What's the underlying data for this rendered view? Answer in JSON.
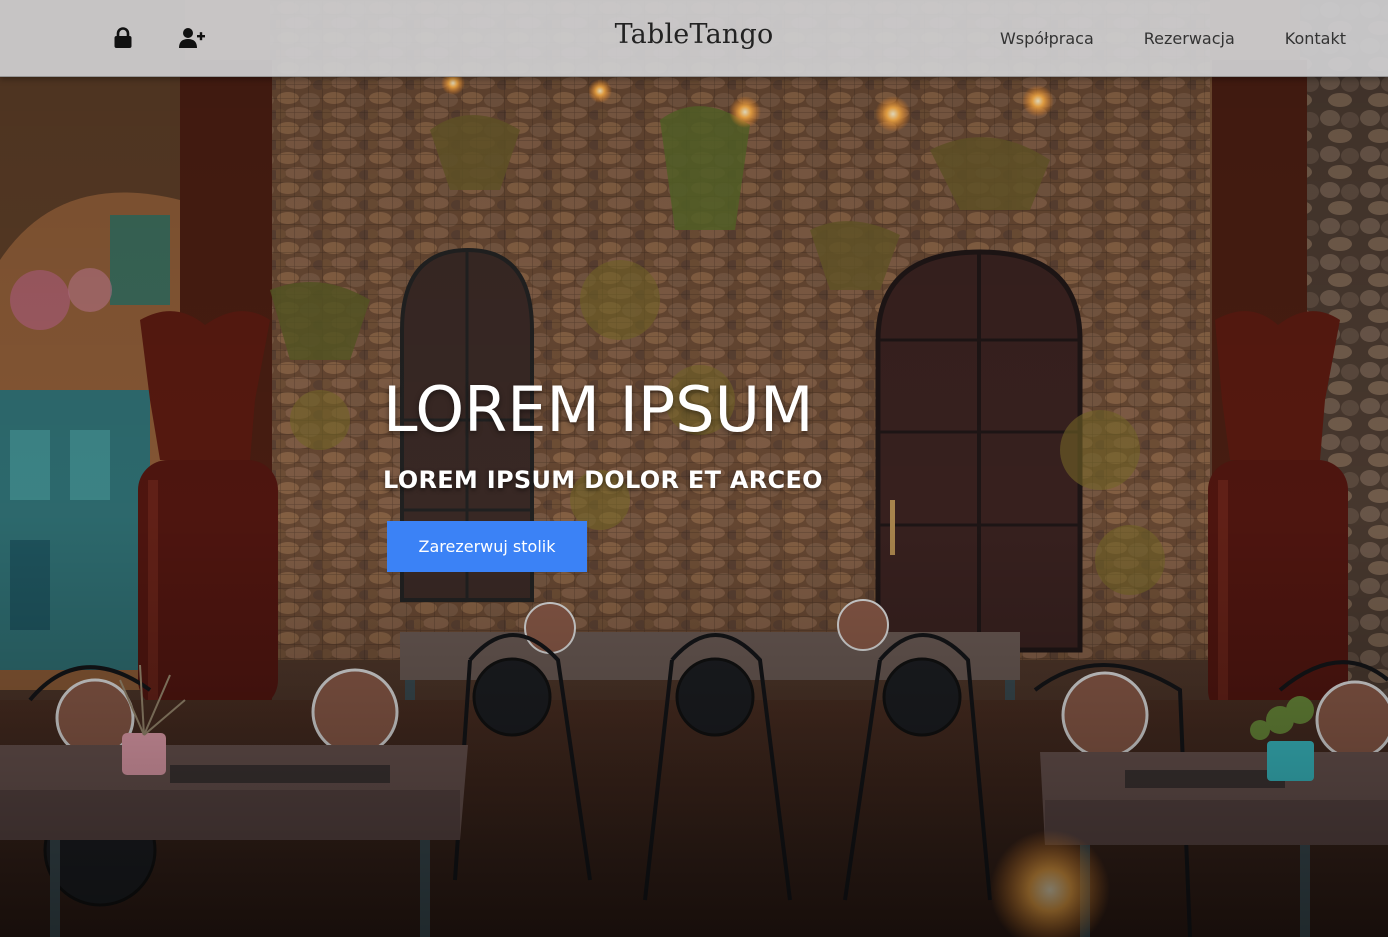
{
  "navbar": {
    "brand": "TableTango",
    "icons": {
      "left": "lock-icon",
      "right": "add-user-icon"
    },
    "links": [
      "Współpraca",
      "Rezerwacja",
      "Kontakt"
    ]
  },
  "hero": {
    "title": "LOREM IPSUM",
    "subtitle": "LOREM IPSUM DOLOR ET ARCEO",
    "cta_label": "Zarezerwuj stolik"
  },
  "colors": {
    "navbar_bg": "#d0d0d2",
    "cta_bg": "#3b82f6",
    "hero_text": "#ffffff"
  }
}
